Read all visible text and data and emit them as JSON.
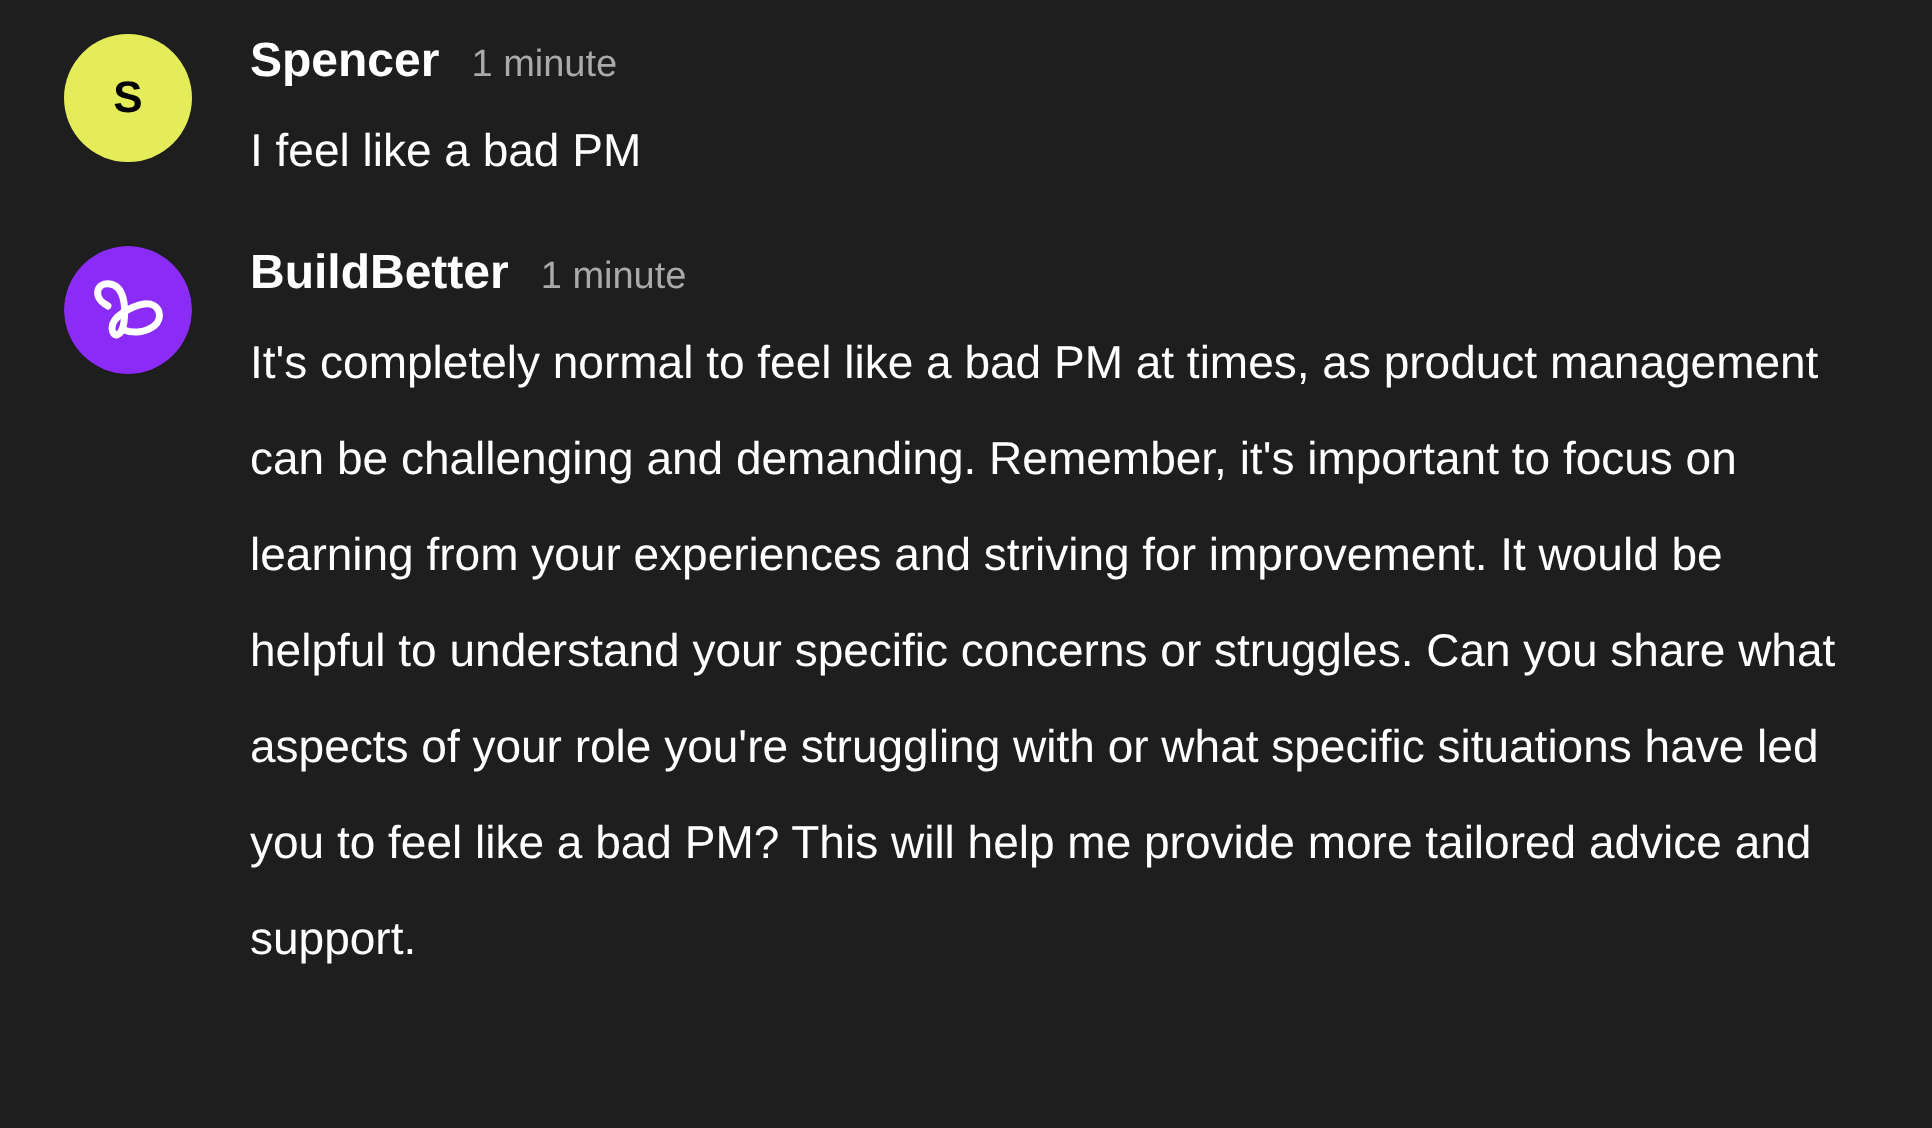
{
  "messages": [
    {
      "avatar": {
        "kind": "initial",
        "text": "S",
        "color": "#e4ec5a"
      },
      "author": "Spencer",
      "time": "1 minute",
      "text": "I feel like a bad PM"
    },
    {
      "avatar": {
        "kind": "logo",
        "color": "#8a2cf6"
      },
      "author": "BuildBetter",
      "time": "1 minute",
      "text": "It's completely normal to feel like a bad PM at times, as product management can be challenging and demanding. Remember, it's important to focus on learning from your experiences and striving for improvement. It would be helpful to understand your specific concerns or struggles. Can you share what aspects of your role you're struggling with or what specific situations have led you to feel like a bad PM? This will help me provide more tailored advice and support."
    }
  ]
}
